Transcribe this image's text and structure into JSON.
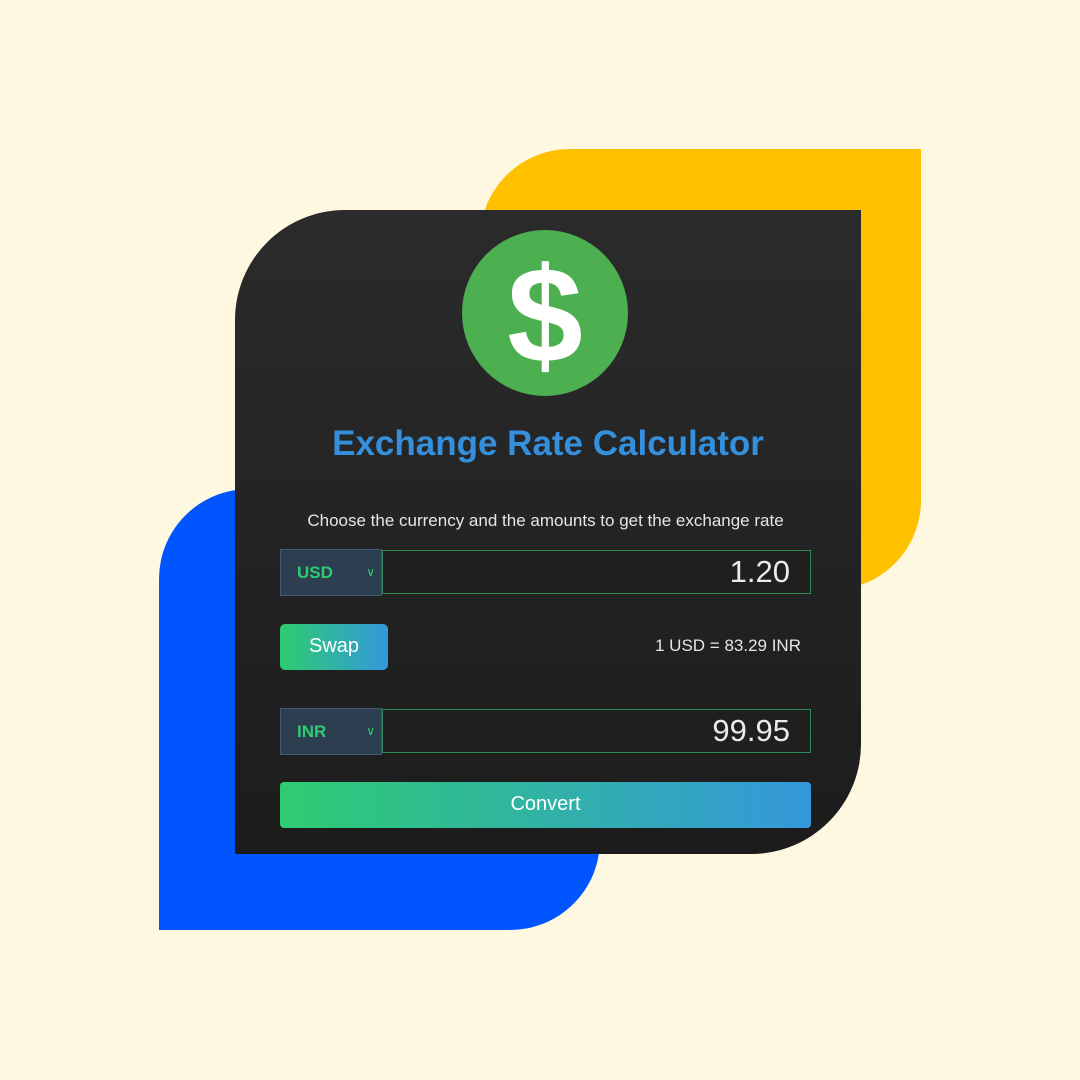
{
  "app": {
    "title": "Exchange Rate Calculator",
    "subtitle": "Choose the currency and the amounts to get the exchange rate"
  },
  "logo": {
    "icon": "dollar-icon",
    "glyph": "$"
  },
  "from": {
    "currency": "USD",
    "amount": "1.20"
  },
  "to": {
    "currency": "INR",
    "amount": "99.95"
  },
  "swap_label": "Swap",
  "rate_text": "1 USD = 83.29 INR",
  "convert_label": "Convert",
  "colors": {
    "background": "#fff8e0",
    "accent_yellow": "#ffc000",
    "accent_blue": "#0055ff",
    "card": "#222222",
    "title": "#3490dc",
    "green": "#2ecc71",
    "logo_green": "#4caf50"
  }
}
